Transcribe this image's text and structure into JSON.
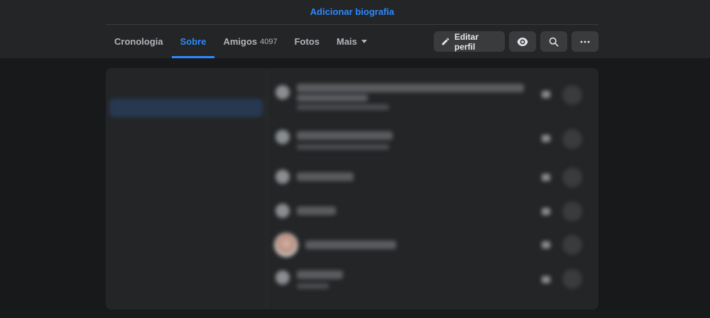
{
  "header": {
    "bio_link": "Adicionar biografia",
    "tabs": [
      {
        "label": "Cronologia",
        "count": ""
      },
      {
        "label": "Sobre",
        "count": ""
      },
      {
        "label": "Amigos",
        "count": "4097"
      },
      {
        "label": "Fotos",
        "count": ""
      },
      {
        "label": "Mais",
        "count": ""
      }
    ],
    "active_tab": "Sobre",
    "edit_profile_label": "Editar perfil"
  },
  "icons": {
    "edit": "pencil-icon",
    "view": "eye-icon",
    "search": "search-icon",
    "more": "ellipsis-icon",
    "dropdown": "chevron-down-icon"
  },
  "colors": {
    "background": "#18191a",
    "surface": "#242526",
    "button": "#3a3b3c",
    "accent": "#2d88ff",
    "text": "#e4e6eb",
    "muted": "#b0b3b8"
  }
}
